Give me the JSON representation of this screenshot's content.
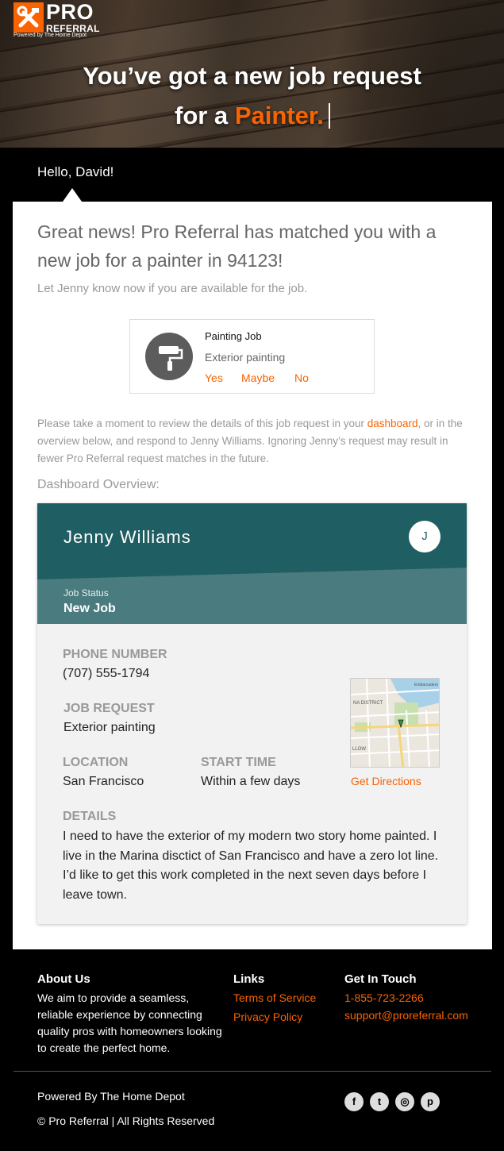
{
  "brand": {
    "logo_pro": "PRO",
    "logo_referral": "REFERRAL",
    "powered_small": "Powered by The Home Depot",
    "accent_color": "#f96302",
    "teal_color": "#1f5e62"
  },
  "hero": {
    "line1": "You’ve got a new job request",
    "line2_prefix": "for a",
    "line2_accent": "Painter."
  },
  "greeting": "Hello, David!",
  "intro": {
    "headline": "Great news! Pro Referral has matched you with a new job for a painter in 94123!",
    "sub": "Let Jenny know now if you are available for the job."
  },
  "job_card": {
    "icon": "paint-roller-icon",
    "title": "Painting Job",
    "type": "Exterior painting",
    "actions": {
      "yes": "Yes",
      "maybe": "Maybe",
      "no": "No"
    }
  },
  "review": {
    "before_link": "Please take a moment to review the details of this job request in your ",
    "link": "dashboard",
    "after_link": ", or in the overview below, and respond to Jenny Williams. Ignoring Jenny’s request may result in fewer Pro Referral request matches in the future."
  },
  "dashboard": {
    "label": "Dashboard Overview:",
    "customer_name": "Jenny Williams",
    "avatar_initial": "J",
    "status_label": "Job Status",
    "status_value": "New Job",
    "phone_label": "PHONE NUMBER",
    "phone_value": "(707) 555-1794",
    "request_label": "JOB REQUEST",
    "request_value": "Exterior painting",
    "location_label": "LOCATION",
    "location_value": "San Francisco",
    "start_label": "START TIME",
    "start_value": "Within a few days",
    "details_label": "DETAILS",
    "details_value": "I need to have the exterior of my modern two story home painted. I live in the Marina disctict of San Francisco and have a zero lot line. I’d like to get this work completed in the next seven days before I leave town.",
    "map_labels": {
      "district": "NA DISTRICT",
      "shoreline": "Embarcadero",
      "llow": "LLOW"
    },
    "directions": "Get Directions"
  },
  "footer": {
    "about_title": "About Us",
    "about_text": "We aim to provide a seamless, reliable experience by connecting quality pros with homeowners looking to create the perfect home.",
    "links_title": "Links",
    "terms": "Terms of Service",
    "privacy": "Privacy Policy",
    "contact_title": "Get In Touch",
    "phone": "1-855-723-2266",
    "email": "support@proreferral.com",
    "powered": "Powered By The Home Depot",
    "copyright": "© Pro Referral | All Rights Reserved",
    "social": {
      "facebook": "f",
      "twitter": "t",
      "instagram": "◎",
      "pinterest": "p"
    }
  }
}
